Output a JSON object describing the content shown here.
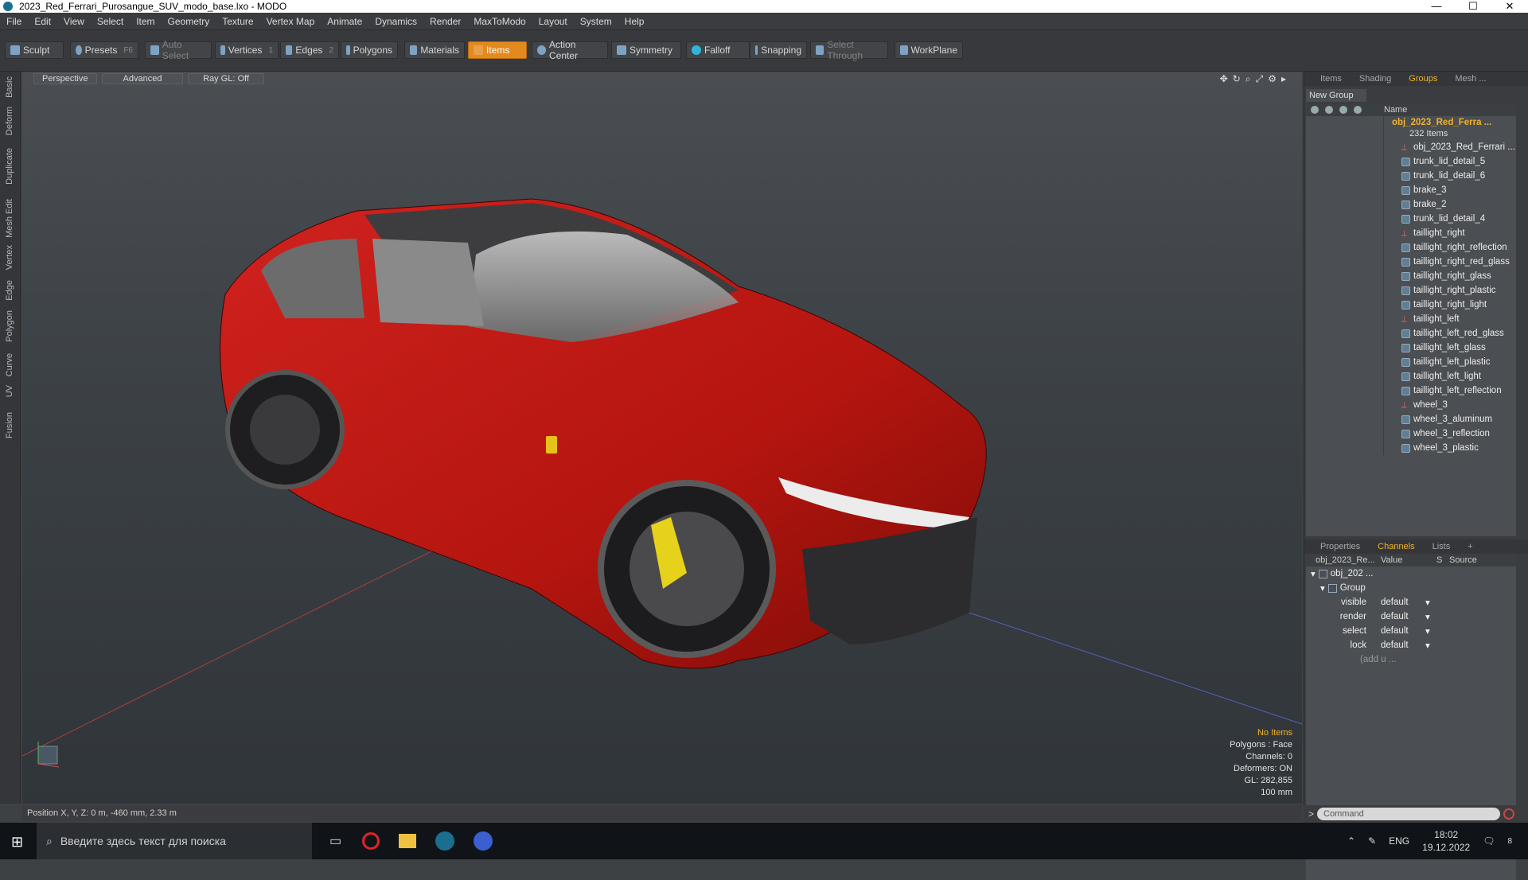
{
  "window": {
    "title": "2023_Red_Ferrari_Purosangue_SUV_modo_base.lxo - MODO"
  },
  "menu": [
    "File",
    "Edit",
    "View",
    "Select",
    "Item",
    "Geometry",
    "Texture",
    "Vertex Map",
    "Animate",
    "Dynamics",
    "Render",
    "MaxToModo",
    "Layout",
    "System",
    "Help"
  ],
  "toolbar": {
    "sculpt": "Sculpt",
    "presets": "Presets",
    "presets_key": "F6",
    "auto_select": "Auto Select",
    "vertices": "Vertices",
    "vertices_key": "1",
    "edges": "Edges",
    "edges_key": "2",
    "polygons": "Polygons",
    "materials": "Materials",
    "items": "Items",
    "action_center": "Action Center",
    "symmetry": "Symmetry",
    "falloff": "Falloff",
    "snapping": "Snapping",
    "select_through": "Select Through",
    "workplane": "WorkPlane"
  },
  "left_tabs": [
    "Basic",
    "Deform",
    "Duplicate",
    "Mesh Edit",
    "Vertex",
    "Edge",
    "Polygon",
    "Curve",
    "UV",
    "Fusion"
  ],
  "viewport": {
    "view": "Perspective",
    "advanced": "Advanced",
    "raygl": "Ray GL: Off",
    "hud": {
      "no_items": "No Items",
      "polygons": "Polygons : Face",
      "channels": "Channels: 0",
      "deformers": "Deformers: ON",
      "gl": "GL: 282,855",
      "scale": "100 mm"
    }
  },
  "status": {
    "position": "Position X, Y, Z:  0 m, -460 mm, 2.33 m"
  },
  "items_panel": {
    "tabs": [
      "Items",
      "Shading",
      "Groups",
      "Mesh ..."
    ],
    "new_group": "New Group",
    "name_header": "Name",
    "root": "obj_2023_Red_Ferra ...",
    "count": "232 Items",
    "items": [
      {
        "name": "obj_2023_Red_Ferrari ...",
        "type": "locator"
      },
      {
        "name": "trunk_lid_detail_5",
        "type": "mesh"
      },
      {
        "name": "trunk_lid_detail_6",
        "type": "mesh"
      },
      {
        "name": "brake_3",
        "type": "mesh"
      },
      {
        "name": "brake_2",
        "type": "mesh"
      },
      {
        "name": "trunk_lid_detail_4",
        "type": "mesh"
      },
      {
        "name": "taillight_right",
        "type": "locator"
      },
      {
        "name": "taillight_right_reflection",
        "type": "mesh"
      },
      {
        "name": "taillight_right_red_glass",
        "type": "mesh"
      },
      {
        "name": "taillight_right_glass",
        "type": "mesh"
      },
      {
        "name": "taillight_right_plastic",
        "type": "mesh"
      },
      {
        "name": "taillight_right_light",
        "type": "mesh"
      },
      {
        "name": "taillight_left",
        "type": "locator"
      },
      {
        "name": "taillight_left_red_glass",
        "type": "mesh"
      },
      {
        "name": "taillight_left_glass",
        "type": "mesh"
      },
      {
        "name": "taillight_left_plastic",
        "type": "mesh"
      },
      {
        "name": "taillight_left_light",
        "type": "mesh"
      },
      {
        "name": "taillight_left_reflection",
        "type": "mesh"
      },
      {
        "name": "wheel_3",
        "type": "locator"
      },
      {
        "name": "wheel_3_aluminum",
        "type": "mesh"
      },
      {
        "name": "wheel_3_reflection",
        "type": "mesh"
      },
      {
        "name": "wheel_3_plastic",
        "type": "mesh"
      }
    ]
  },
  "channels_panel": {
    "tabs": [
      "Properties",
      "Channels",
      "Lists",
      "+"
    ],
    "col_name": "obj_2023_Re...",
    "col_value": "Value",
    "col_s": "S",
    "col_source": "Source",
    "root": "obj_202 ...",
    "group": "Group",
    "rows": [
      {
        "name": "visible",
        "value": "default"
      },
      {
        "name": "render",
        "value": "default"
      },
      {
        "name": "select",
        "value": "default"
      },
      {
        "name": "lock",
        "value": "default"
      }
    ],
    "add": "(add u ..."
  },
  "command": {
    "placeholder": "Command"
  },
  "taskbar": {
    "search_placeholder": "Введите здесь текст для поиска",
    "lang": "ENG",
    "time": "18:02",
    "date": "19.12.2022",
    "notif": "8"
  }
}
